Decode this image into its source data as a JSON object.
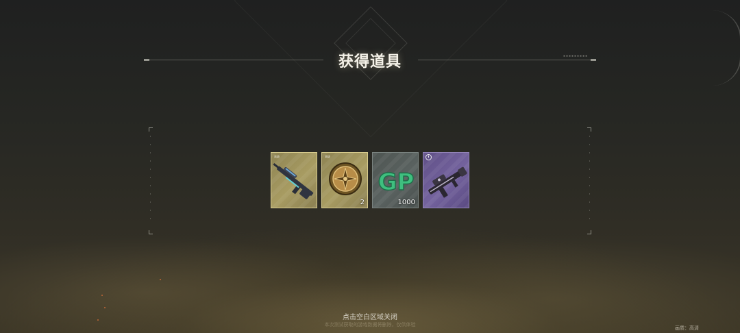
{
  "header": {
    "title": "获得道具"
  },
  "items": [
    {
      "name": "sniper-rifle",
      "rarity": "gold",
      "tag": "高级",
      "quantity": ""
    },
    {
      "name": "gold-medal",
      "rarity": "gold",
      "tag": "高级",
      "quantity": "2"
    },
    {
      "name": "gp-currency",
      "rarity": "gray",
      "tag": "",
      "quantity": "1000",
      "icon_text": "GP"
    },
    {
      "name": "dark-rifle",
      "rarity": "purple",
      "tag": "",
      "quantity": ""
    }
  ],
  "footer": {
    "close_hint": "点击空白区域关闭",
    "subtext": "本次测试获取的游戏数据将删除，仅供体验",
    "quality": "画质：高清"
  },
  "colors": {
    "gold": "#a89c62",
    "gray": "#5a6260",
    "purple": "#74639e",
    "gp_green": "#3fbf7f"
  }
}
